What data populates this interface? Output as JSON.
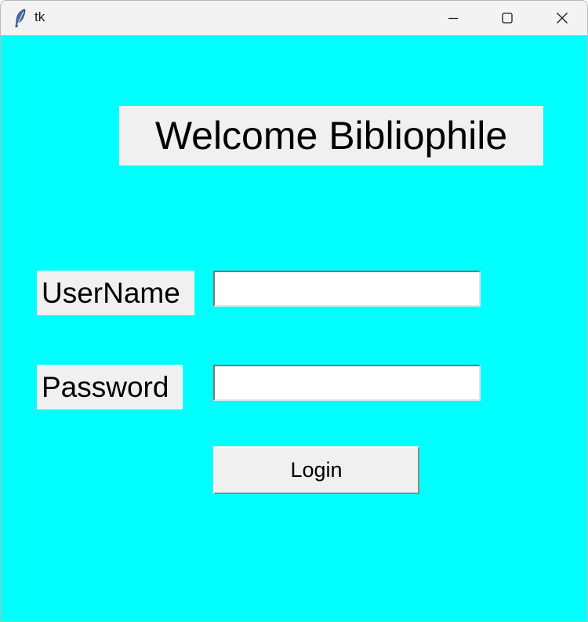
{
  "window": {
    "title": "tk",
    "background_color": "#00ffff",
    "titlebar_color": "#f3f3f3",
    "controls": [
      "minimize-icon",
      "maximize-icon",
      "close-icon"
    ]
  },
  "app_icon": "feather-icon",
  "heading": {
    "text": "Welcome Bibliophile"
  },
  "form": {
    "username_label": "UserName",
    "username_value": "",
    "password_label": "Password",
    "password_value": "",
    "login_label": "Login"
  },
  "colors": {
    "label_background": "#f0f0f0",
    "entry_background": "#ffffff"
  }
}
